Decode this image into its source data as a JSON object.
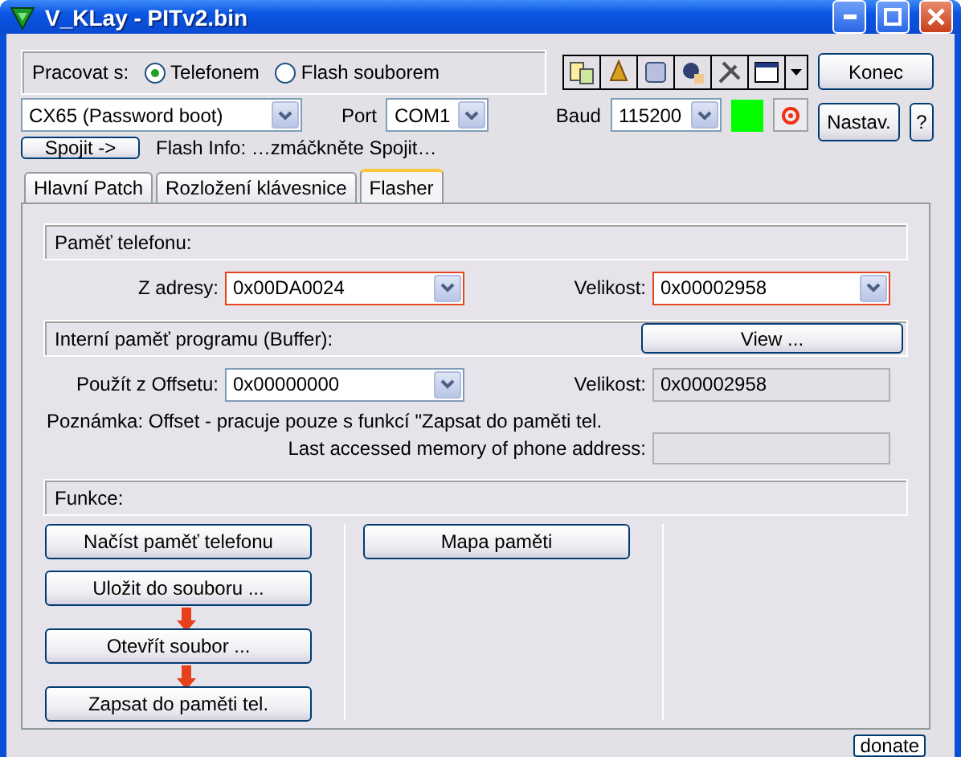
{
  "window": {
    "title": "V_KLay - PITv2.bin"
  },
  "mode": {
    "label": "Pracovat s:",
    "options": [
      {
        "label": "Telefonem",
        "selected": true
      },
      {
        "label": "Flash souborem",
        "selected": false
      }
    ]
  },
  "phone_model": {
    "value": "CX65 (Password boot)"
  },
  "port": {
    "label": "Port",
    "value": "COM1"
  },
  "baud": {
    "label": "Baud",
    "value": "115200"
  },
  "connect_button": "Spojit ->",
  "flash_info": "Flash Info: …zmáčkněte Spojit…",
  "side_buttons": {
    "close": "Konec",
    "settings": "Nastav.",
    "help": "?"
  },
  "tabs": [
    {
      "label": "Hlavní Patch",
      "selected": false
    },
    {
      "label": "Rozložení klávesnice",
      "selected": false
    },
    {
      "label": "Flasher",
      "selected": true
    }
  ],
  "phone_memory": {
    "title": "Paměť telefonu:",
    "address": {
      "label": "Z adresy:",
      "value": "0x00DA0024",
      "highlighted": true
    },
    "size": {
      "label": "Velikost:",
      "value": "0x00002958",
      "highlighted": true
    }
  },
  "buffer": {
    "title": "Interní paměť programu (Buffer):",
    "view_button": "View ...",
    "offset": {
      "label": "Použít z Offsetu:",
      "value": "0x00000000",
      "highlighted": false
    },
    "size": {
      "label": "Velikost:",
      "value": "0x00002958"
    },
    "note": "Poznámka: Offset - pracuje pouze s funkcí \"Zapsat do paměti tel.",
    "last_accessed": {
      "label": "Last accessed memory of phone address:"
    }
  },
  "functions": {
    "title": "Funkce:",
    "column_1": [
      {
        "label": "Načíst paměť telefonu",
        "arrow_before": false
      },
      {
        "label": "Uložit do souboru ...",
        "arrow_before": false
      },
      {
        "label": "Otevřít soubor ...",
        "arrow_before": true
      },
      {
        "label": "Zapsat do paměti tel.",
        "arrow_before": true
      }
    ],
    "column_2": [
      {
        "label": "Mapa paměti",
        "arrow_before": false
      }
    ]
  },
  "donate_button": "donate"
}
